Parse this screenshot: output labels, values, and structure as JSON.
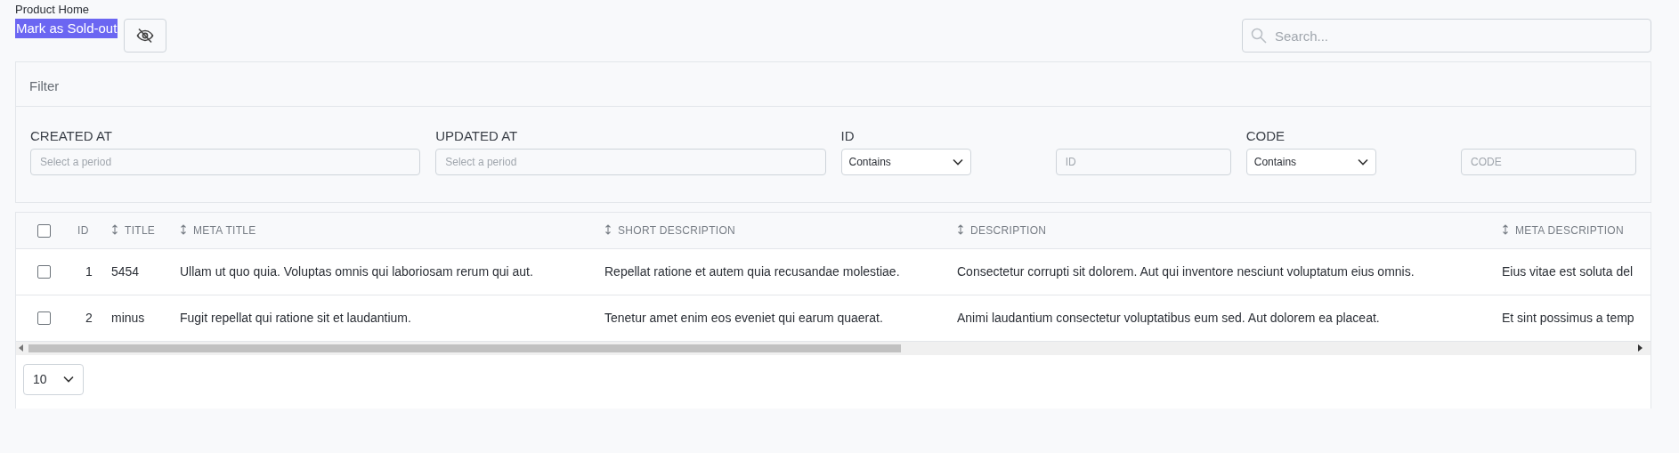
{
  "page_title": "Product Home",
  "selection_action": "Mark as Sold-out",
  "search": {
    "placeholder": "Search..."
  },
  "filter": {
    "title": "Filter",
    "fields": [
      {
        "kind": "period",
        "label": "CREATED AT",
        "placeholder": "Select a period"
      },
      {
        "kind": "period",
        "label": "UPDATED AT",
        "placeholder": "Select a period"
      },
      {
        "kind": "text",
        "label": "ID",
        "operator": "Contains",
        "placeholder": "ID"
      },
      {
        "kind": "text",
        "label": "CODE",
        "operator": "Contains",
        "placeholder": "CODE"
      }
    ]
  },
  "table": {
    "all_checked": false,
    "columns": [
      {
        "label": "ID",
        "sortable": false
      },
      {
        "label": "TITLE",
        "sortable": true
      },
      {
        "label": "META TITLE",
        "sortable": true
      },
      {
        "label": "SHORT DESCRIPTION",
        "sortable": true
      },
      {
        "label": "DESCRIPTION",
        "sortable": true
      },
      {
        "label": "META DESCRIPTION",
        "sortable": true
      }
    ],
    "rows": [
      {
        "checked": false,
        "cells": [
          "1",
          "5454",
          "Ullam ut quo quia. Voluptas omnis qui laboriosam rerum qui aut.",
          "Repellat ratione et autem quia recusandae molestiae.",
          "Consectetur corrupti sit dolorem. Aut qui inventore nesciunt voluptatum eius omnis.",
          "Eius vitae est soluta del"
        ]
      },
      {
        "checked": false,
        "cells": [
          "2",
          "minus",
          "Fugit repellat qui ratione sit et laudantium.",
          "Tenetur amet enim eos eveniet qui earum quaerat.",
          "Animi laudantium consectetur voluptatibus eum sed. Aut dolorem ea placeat.",
          "Et sint possimus a temp"
        ]
      }
    ]
  },
  "per_page": "10"
}
